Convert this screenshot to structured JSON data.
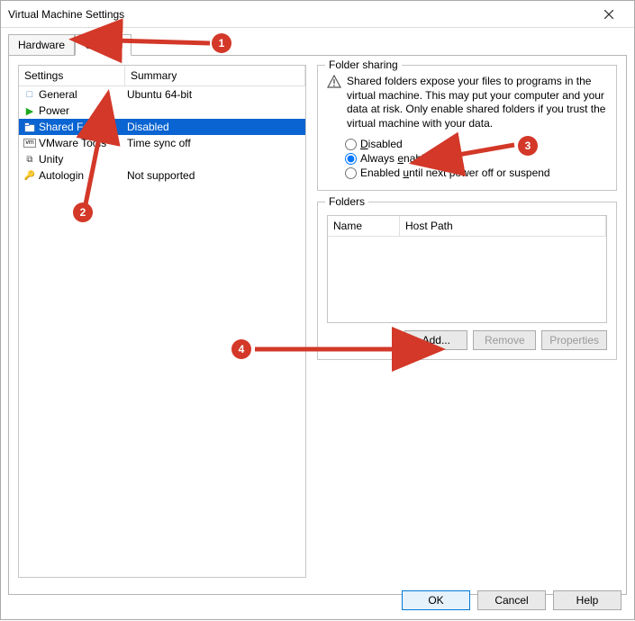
{
  "window": {
    "title": "Virtual Machine Settings"
  },
  "tabs": {
    "hardware": "Hardware",
    "options": "Options"
  },
  "list": {
    "header_settings": "Settings",
    "header_summary": "Summary",
    "rows": [
      {
        "name": "General",
        "summary": "Ubuntu 64-bit"
      },
      {
        "name": "Power",
        "summary": ""
      },
      {
        "name": "Shared Folders",
        "summary": "Disabled"
      },
      {
        "name": "VMware Tools",
        "summary": "Time sync off"
      },
      {
        "name": "Unity",
        "summary": ""
      },
      {
        "name": "Autologin",
        "summary": "Not supported"
      }
    ]
  },
  "folder_sharing": {
    "legend": "Folder sharing",
    "warning": "Shared folders expose your files to programs in the virtual machine. This may put your computer and your data at risk. Only enable shared folders if you trust the virtual machine with your data.",
    "opt_disabled": "Disabled",
    "opt_always": "Always enabled",
    "opt_until": "Enabled until next power off or suspend"
  },
  "folders": {
    "legend": "Folders",
    "col_name": "Name",
    "col_host": "Host Path",
    "btn_add": "Add...",
    "btn_remove": "Remove",
    "btn_props": "Properties"
  },
  "footer": {
    "ok": "OK",
    "cancel": "Cancel",
    "help": "Help"
  },
  "annotations": [
    "1",
    "2",
    "3",
    "4"
  ]
}
